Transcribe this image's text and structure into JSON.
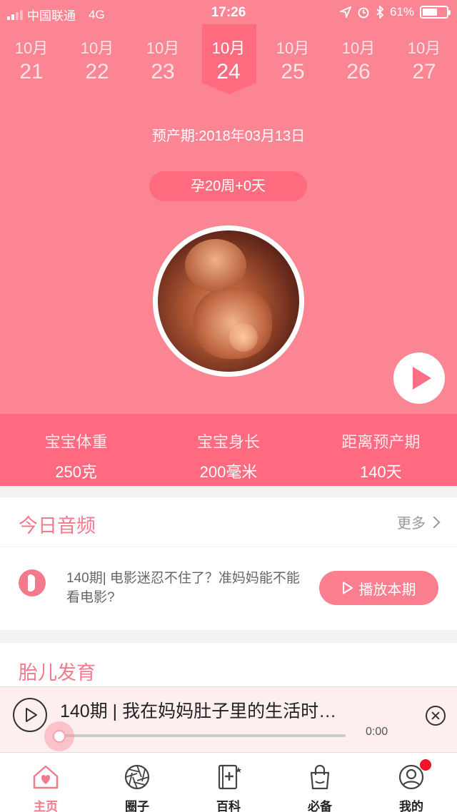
{
  "status_bar": {
    "carrier": "中国联通",
    "network": "4G",
    "time": "17:26",
    "battery": "61%",
    "battery_level": 0.61
  },
  "dates": [
    {
      "month": "10月",
      "day": "21"
    },
    {
      "month": "10月",
      "day": "22"
    },
    {
      "month": "10月",
      "day": "23"
    },
    {
      "month": "10月",
      "day": "24",
      "selected": true
    },
    {
      "month": "10月",
      "day": "25"
    },
    {
      "month": "10月",
      "day": "26"
    },
    {
      "month": "10月",
      "day": "27"
    }
  ],
  "due_date": "预产期:2018年03月13日",
  "pregnancy_week": "孕20周+0天",
  "stats": [
    {
      "label": "宝宝体重",
      "value": "250克"
    },
    {
      "label": "宝宝身长",
      "value": "200毫米"
    },
    {
      "label": "距离预产期",
      "value": "140天"
    }
  ],
  "audio": {
    "title": "今日音频",
    "more": "更多",
    "item_text": "140期| 电影迷忍不住了？准妈妈能不能看电影?",
    "play_label": "播放本期"
  },
  "fetal": {
    "title": "胎儿发育"
  },
  "player": {
    "title": "140期 | 我在妈妈肚子里的生活时…",
    "time": "0:00",
    "progress": 0
  },
  "tabs": [
    {
      "label": "主页",
      "icon": "home-heart-icon",
      "active": true
    },
    {
      "label": "圈子",
      "icon": "circle-aperture-icon"
    },
    {
      "label": "百科",
      "icon": "book-plus-icon"
    },
    {
      "label": "必备",
      "icon": "shopping-bag-icon"
    },
    {
      "label": "我的",
      "icon": "user-profile-icon"
    }
  ],
  "colors": {
    "hero": "#fb8593",
    "accent": "#ff6b7f",
    "title_pink": "#f27a8c",
    "badge": "#f0142a"
  }
}
